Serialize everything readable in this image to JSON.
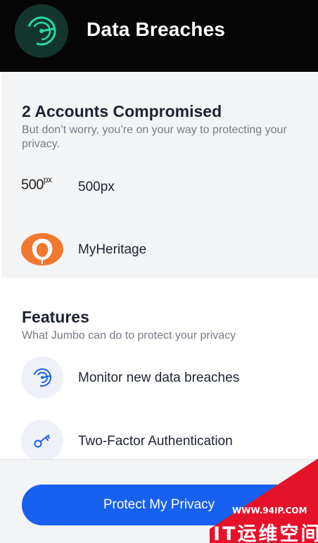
{
  "header": {
    "title": "Data Breaches",
    "logo_icon": "gauge-icon"
  },
  "breaches": {
    "title": "2 Accounts Compromised",
    "subtitle": "But don’t worry, you’re on your way to protecting your privacy.",
    "items": [
      {
        "label": "500px",
        "logo_text": "500",
        "logo_sup": "px",
        "icon": "500px-logo"
      },
      {
        "label": "MyHeritage",
        "icon": "myheritage-logo"
      }
    ]
  },
  "features": {
    "title": "Features",
    "subtitle": "What Jumbo can do to protect your privacy",
    "items": [
      {
        "label": "Monitor new data breaches",
        "icon": "radar-icon"
      },
      {
        "label": "Two-Factor Authentication",
        "icon": "key-icon"
      }
    ]
  },
  "footer": {
    "cta_label": "Protect My Privacy"
  },
  "watermark": {
    "url": "WWW.94IP.COM",
    "text": "IT运维空间"
  },
  "colors": {
    "header_bg": "#050505",
    "accent_green": "#2bd99f",
    "cta_blue": "#1760f0",
    "watermark_red": "#e5122a",
    "myheritage_orange": "#f2792f"
  }
}
